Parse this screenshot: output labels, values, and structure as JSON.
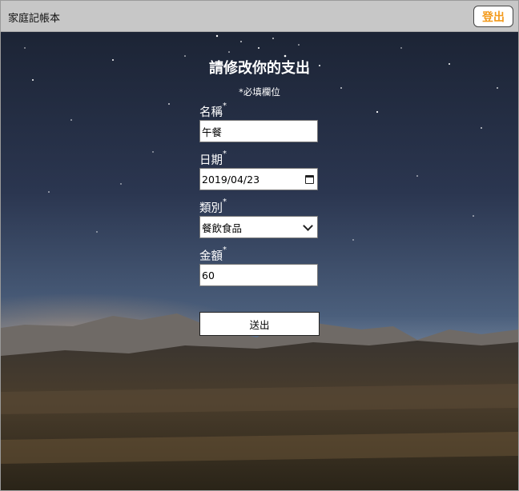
{
  "app": {
    "title": "家庭記帳本",
    "logout_label": "登出"
  },
  "form": {
    "title": "請修改你的支出",
    "required_note": "*必填欄位",
    "required_marker": "*",
    "name": {
      "label": "名稱",
      "value": "午餐"
    },
    "date": {
      "label": "日期",
      "value": "2019/04/23"
    },
    "category": {
      "label": "類別",
      "value": "餐飲食品"
    },
    "amount": {
      "label": "金額",
      "value": "60"
    },
    "submit_label": "送出"
  },
  "colors": {
    "accent": "#f39a1c",
    "topbar": "#c7c7c7"
  }
}
